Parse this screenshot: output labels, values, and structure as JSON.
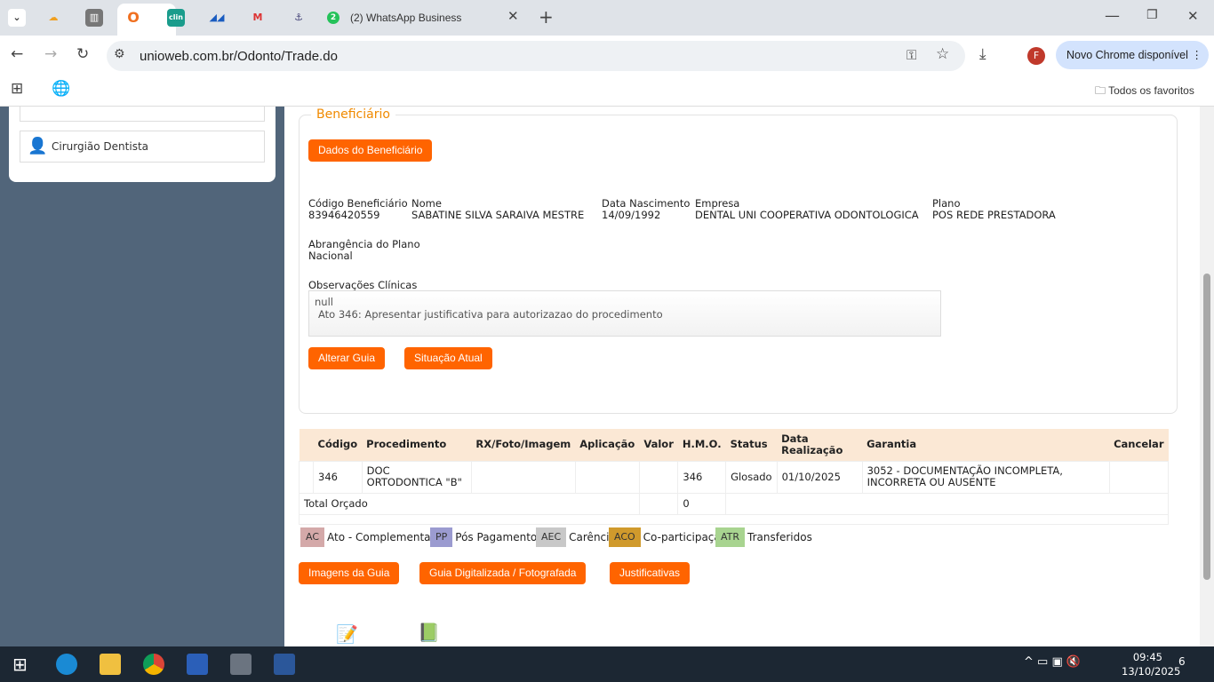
{
  "browser": {
    "whatsapp_tab": "(2) WhatsApp Business",
    "url": "unioweb.com.br/Odonto/Trade.do",
    "update_button": "Novo Chrome disponível",
    "profile_initial": "F",
    "all_bookmarks": "Todos os favoritos"
  },
  "sidebar": {
    "item": "Cirurgião Dentista"
  },
  "beneficiary": {
    "legend": "Beneficiário",
    "data_button": "Dados do Beneficiário",
    "fields": [
      {
        "label": "Código Beneficiário",
        "value": "83946420559"
      },
      {
        "label": "Nome",
        "value": "SABATINE SILVA SARAIVA MESTRE"
      },
      {
        "label": "Data Nascimento",
        "value": "14/09/1992"
      },
      {
        "label": "Empresa",
        "value": "DENTAL UNI COOPERATIVA ODONTOLOGICA"
      },
      {
        "label": "Plano",
        "value": "POS REDE PRESTADORA"
      }
    ],
    "coverage_label": "Abrangência do Plano",
    "coverage_value": "Nacional",
    "obs_label": "Observações Clínicas",
    "obs_line1": "null",
    "obs_line2": "Ato 346: Apresentar justificativa para autorizazao do procedimento",
    "alter_button": "Alterar Guia",
    "status_button": "Situação Atual"
  },
  "table": {
    "headers": [
      "Código",
      "Procedimento",
      "RX/Foto/Imagem",
      "Aplicação",
      "Valor",
      "H.M.O.",
      "Status",
      "Data Realização",
      "Garantia",
      "Cancelar"
    ],
    "row": {
      "codigo": "346",
      "procedimento": "DOC ORTODONTICA \"B\"",
      "rx": "",
      "aplicacao": "",
      "valor": "",
      "hmo": "346",
      "status": "Glosado",
      "data": "01/10/2025",
      "garantia": "3052 - DOCUMENTAÇÃO INCOMPLETA, INCORRETA OU AUSENTE"
    },
    "total_label": "Total Orçado",
    "total_value": "0"
  },
  "legend": [
    {
      "code": "AC",
      "label": "Ato - Complementar",
      "color": "#d4a9a9"
    },
    {
      "code": "PP",
      "label": "Pós Pagamento",
      "color": "#9b9bd0"
    },
    {
      "code": "AEC",
      "label": "Carência",
      "color": "#c8c8c8"
    },
    {
      "code": "ACO",
      "label": "Co-participação",
      "color": "#d09a2c"
    },
    {
      "code": "ATR",
      "label": "Transferidos",
      "color": "#a8d490"
    }
  ],
  "actions": {
    "images": "Imagens da Guia",
    "scanned": "Guia Digitalizada / Fotografada",
    "justifications": "Justificativas"
  },
  "taskbar": {
    "time": "09:45",
    "date": "13/10/2025",
    "notifications": "6"
  }
}
